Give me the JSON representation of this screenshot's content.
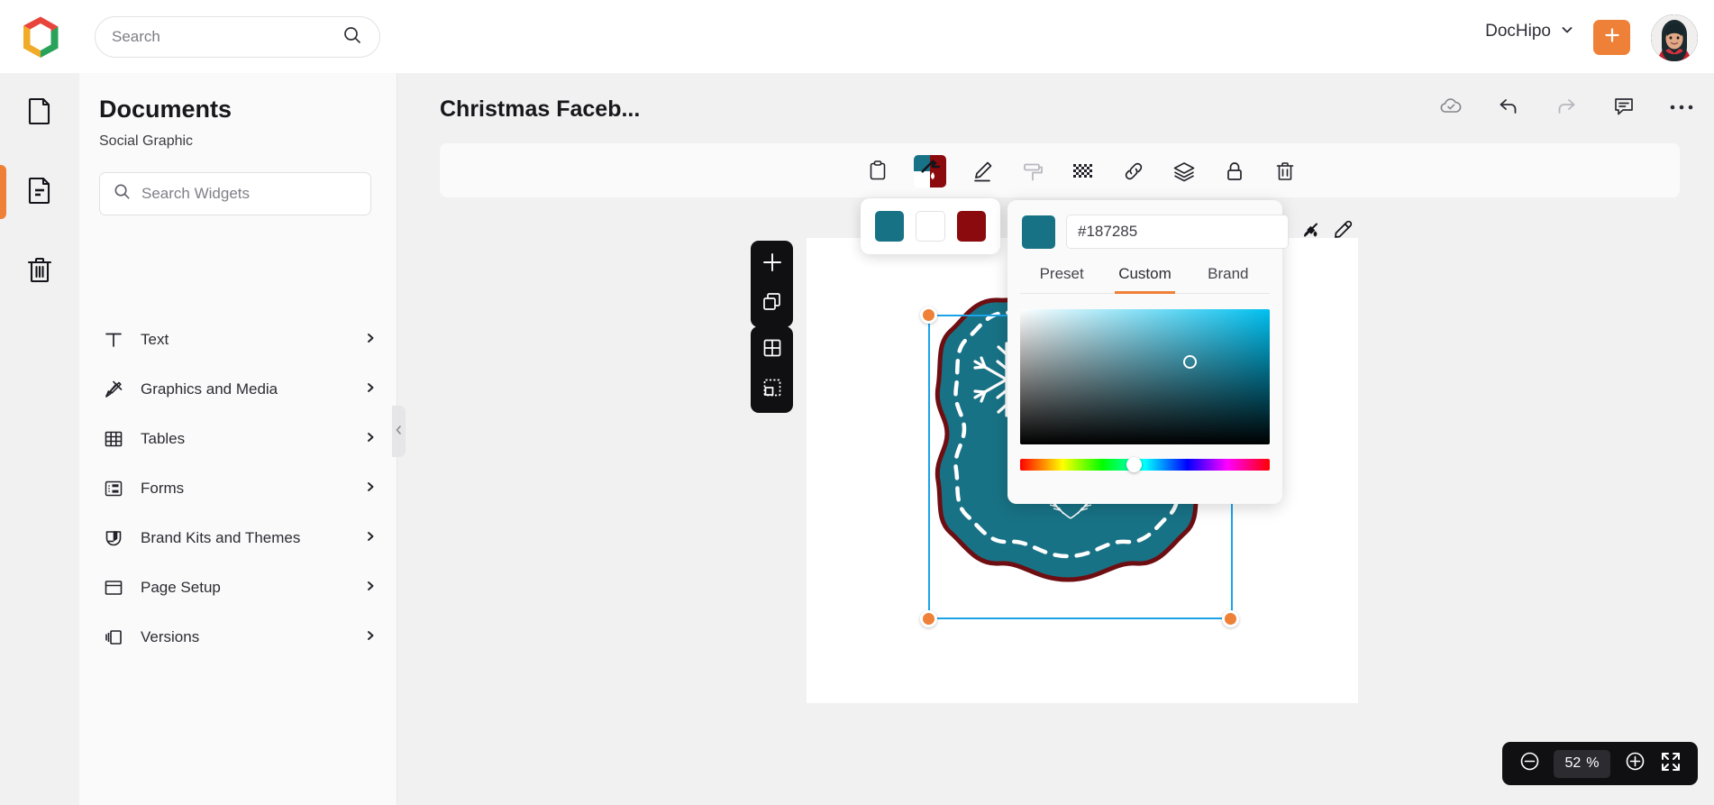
{
  "topbar": {
    "logo_icon": "dochipo-logo-icon",
    "search": {
      "value": "",
      "placeholder": "Search",
      "icon": "search-icon"
    },
    "brand_label": "DocHipo",
    "brand_chevron_icon": "chevron-down-icon",
    "create_button_icon": "plus-icon",
    "avatar_icon": "user-avatar"
  },
  "rail": {
    "items": [
      {
        "name": "blank-document",
        "icon": "document-icon",
        "active": false
      },
      {
        "name": "my-documents",
        "icon": "document-lines-icon",
        "active": true
      },
      {
        "name": "trash",
        "icon": "trash-icon",
        "active": false
      }
    ]
  },
  "sidebar": {
    "title": "Documents",
    "subtitle": "Social Graphic",
    "search": {
      "value": "",
      "placeholder": "Search Widgets",
      "icon": "search-icon"
    },
    "items": [
      {
        "label": "Text",
        "icon": "text-t-icon"
      },
      {
        "label": "Graphics and Media",
        "icon": "graphics-media-icon"
      },
      {
        "label": "Tables",
        "icon": "table-grid-icon"
      },
      {
        "label": "Forms",
        "icon": "forms-icon"
      },
      {
        "label": "Brand Kits and Themes",
        "icon": "brand-shield-icon"
      },
      {
        "label": "Page Setup",
        "icon": "page-setup-icon"
      },
      {
        "label": "Versions",
        "icon": "versions-layers-icon"
      }
    ],
    "collapse_icon": "chevron-left-icon"
  },
  "editor": {
    "document_title": "Christmas Faceb...",
    "actions": [
      {
        "name": "save-status",
        "icon": "cloud-check-icon"
      },
      {
        "name": "undo",
        "icon": "undo-arrow-icon"
      },
      {
        "name": "redo",
        "icon": "redo-arrow-icon"
      },
      {
        "name": "comments",
        "icon": "comment-icon"
      },
      {
        "name": "more-options",
        "icon": "more-horizontal-icon"
      }
    ]
  },
  "element_toolbar": {
    "buttons": [
      {
        "name": "paste-clipboard",
        "icon": "clipboard-icon",
        "active": false
      },
      {
        "name": "color-fill",
        "icon": "color-swatch-icon",
        "active": true
      },
      {
        "name": "edit-pencil",
        "icon": "pencil-icon",
        "active": false
      },
      {
        "name": "paint-roller",
        "icon": "paint-roller-icon",
        "active": false
      },
      {
        "name": "transparency",
        "icon": "checkerboard-icon",
        "active": false
      },
      {
        "name": "add-link",
        "icon": "link-icon",
        "active": false
      },
      {
        "name": "layers",
        "icon": "layers-icon",
        "active": false
      },
      {
        "name": "lock",
        "icon": "lock-icon",
        "active": false
      },
      {
        "name": "delete",
        "icon": "trash-icon",
        "active": false
      }
    ]
  },
  "swatch_popup": {
    "swatches": [
      {
        "name": "swatch-teal",
        "color": "#187285"
      },
      {
        "name": "swatch-white",
        "color": "#ffffff"
      },
      {
        "name": "swatch-dark-red",
        "color": "#8a0a0d"
      }
    ]
  },
  "color_picker": {
    "current_color": "#187285",
    "hex_value": "#187285",
    "no_color_icon": "no-color-icon",
    "eyedropper_icon": "eyedropper-icon",
    "tabs": [
      {
        "label": "Preset",
        "active": false
      },
      {
        "label": "Custom",
        "active": true
      },
      {
        "label": "Brand",
        "active": false
      }
    ],
    "accent_color": "#ef8037",
    "sv_hue_color": "#00c0f0"
  },
  "page_tools": {
    "group_one": [
      {
        "name": "add-page",
        "icon": "plus-icon"
      },
      {
        "name": "duplicate-page",
        "icon": "duplicate-icon"
      }
    ],
    "group_two": [
      {
        "name": "page-grid",
        "icon": "grid-icon"
      },
      {
        "name": "select-area",
        "icon": "marquee-select-icon"
      }
    ]
  },
  "canvas": {
    "shape_fill": "#187285",
    "shape_stroke": "#6e0e12",
    "dashed_border_color": "#ffffff",
    "decorations": [
      {
        "name": "snowflake-icon"
      },
      {
        "name": "laurel-wreath-icon"
      }
    ],
    "selection": {
      "handle_color": "#ef8037",
      "border_color": "#1ba3e8"
    }
  },
  "zoom": {
    "minus_icon": "zoom-out-icon",
    "value": "52",
    "unit": "%",
    "plus_icon": "zoom-in-icon",
    "fullscreen_icon": "fullscreen-icon"
  }
}
